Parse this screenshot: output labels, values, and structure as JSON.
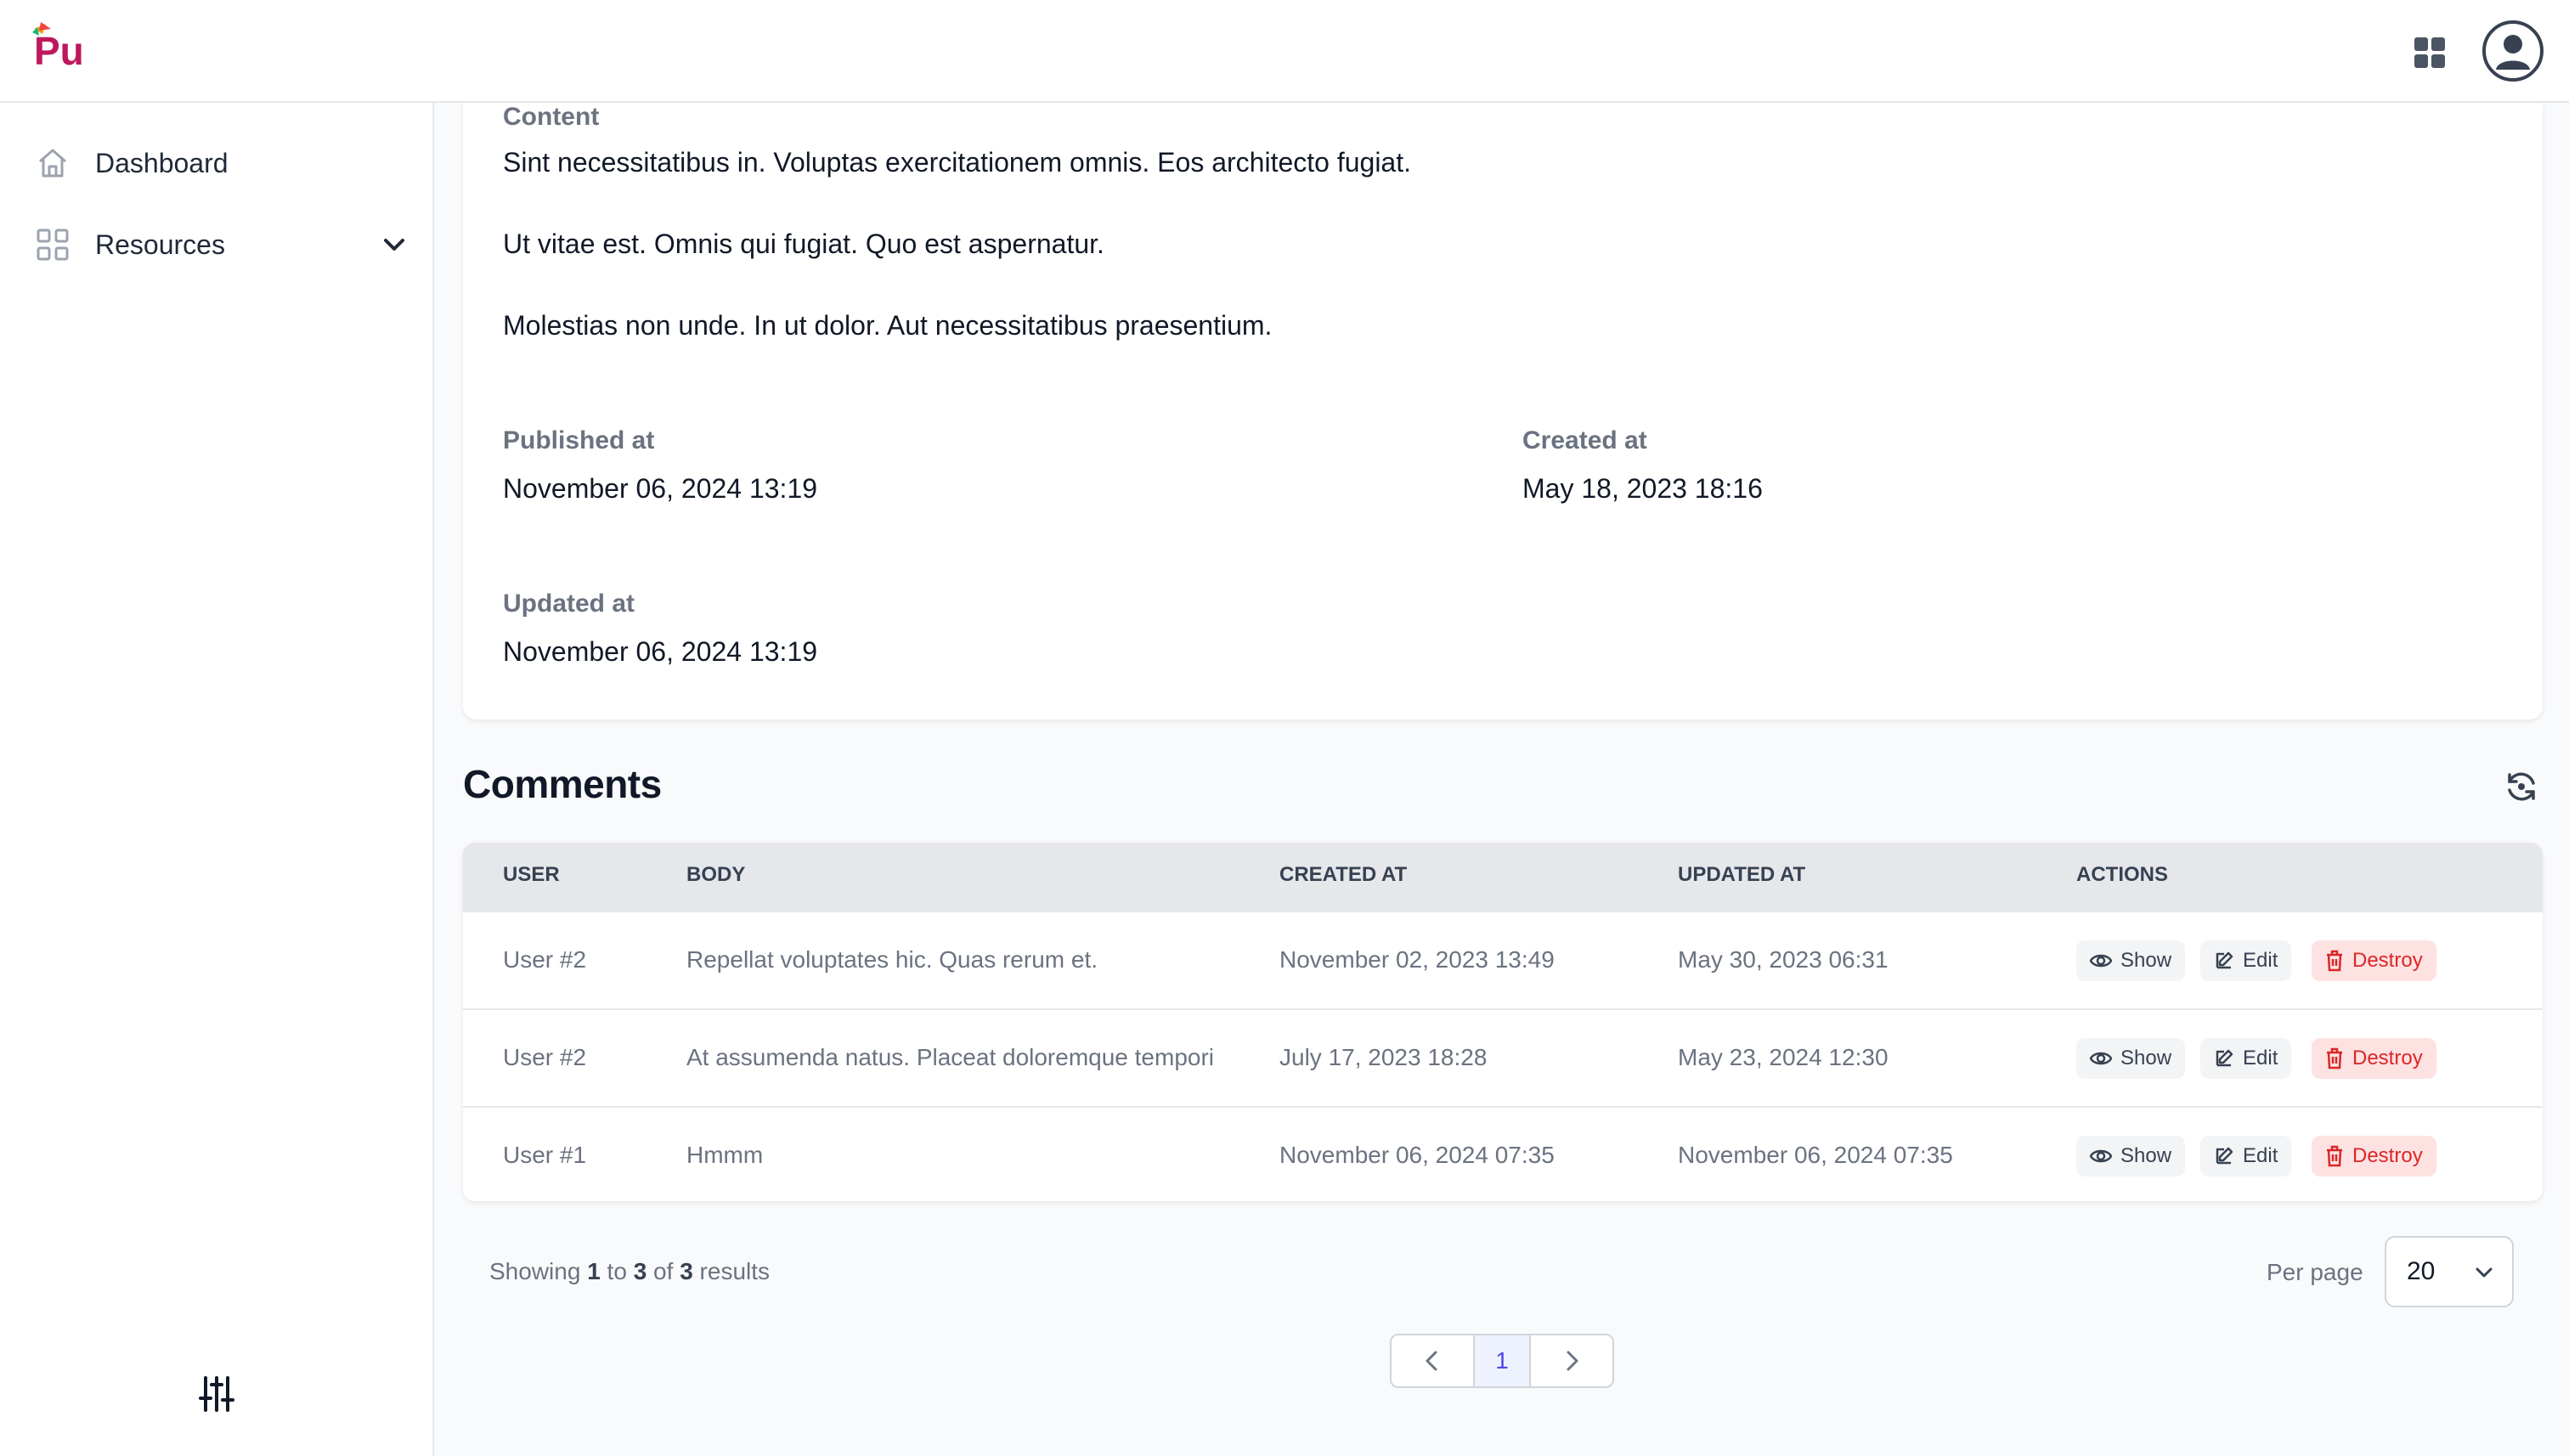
{
  "header": {
    "logo_text": "Pu",
    "apps_icon": "grid-icon",
    "avatar_icon": "user-avatar-icon"
  },
  "sidebar": {
    "items": [
      {
        "label": "Dashboard",
        "icon": "home-icon"
      },
      {
        "label": "Resources",
        "icon": "grid-icon",
        "expandable": true
      }
    ],
    "settings_icon": "sliders-icon"
  },
  "detail": {
    "content_label": "Content",
    "content_paragraphs": [
      "Sint necessitatibus in. Voluptas exercitationem omnis. Eos architecto fugiat.",
      "Ut vitae est. Omnis qui fugiat. Quo est aspernatur.",
      "Molestias non unde. In ut dolor. Aut necessitatibus praesentium."
    ],
    "published_label": "Published at",
    "published_value": "November 06, 2024 13:19",
    "created_label": "Created at",
    "created_value": "May 18, 2023 18:16",
    "updated_label": "Updated at",
    "updated_value": "November 06, 2024 13:19"
  },
  "comments": {
    "title": "Comments",
    "columns": [
      "USER",
      "BODY",
      "CREATED AT",
      "UPDATED AT",
      "ACTIONS"
    ],
    "rows": [
      {
        "user": "User #2",
        "body": "Repellat voluptates hic. Quas rerum et.",
        "created": "November 02, 2023 13:49",
        "updated": "May 30, 2023 06:31"
      },
      {
        "user": "User #2",
        "body": "At assumenda natus. Placeat doloremque tempori",
        "created": "July 17, 2023 18:28",
        "updated": "May 23, 2024 12:30"
      },
      {
        "user": "User #1",
        "body": "Hmmm",
        "created": "November 06, 2024 07:35",
        "updated": "November 06, 2024 07:35"
      }
    ],
    "actions": {
      "show": "Show",
      "edit": "Edit",
      "destroy": "Destroy"
    }
  },
  "pagination": {
    "showing": "Showing",
    "from": "1",
    "to_word": "to",
    "to": "3",
    "of_word": "of",
    "total": "3",
    "results_word": "results",
    "per_page_label": "Per page",
    "per_page_value": "20",
    "current_page": "1"
  },
  "colors": {
    "accent": "#4f46e5",
    "destroy": "#dc2626"
  }
}
